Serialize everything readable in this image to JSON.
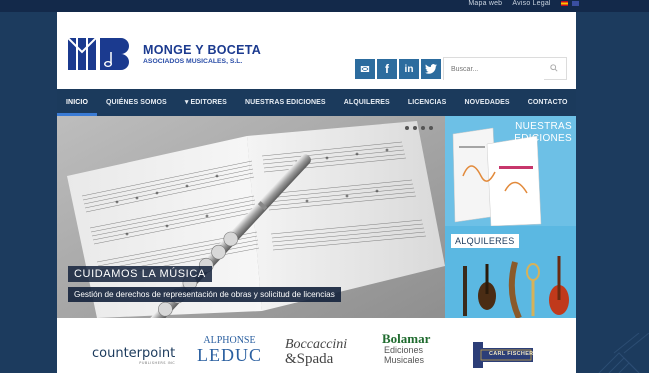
{
  "top_links": [
    "Mapa web",
    "Aviso Legal"
  ],
  "colors": {
    "page_bg": "#1c3b5e",
    "nav_bg": "#1b3a5c",
    "brand_blue": "#1b3a8f",
    "social_bg": "#2c6c9e",
    "side_panel": "#6dc0e6"
  },
  "brand": {
    "name": "MONGE Y BOCETA",
    "sub": "ASOCIADOS MUSICALES, S.L."
  },
  "social": [
    {
      "icon": "mail-icon",
      "glyph": "✉"
    },
    {
      "icon": "facebook-icon",
      "glyph": "f"
    },
    {
      "icon": "linkedin-icon",
      "glyph": "in"
    },
    {
      "icon": "twitter-icon",
      "glyph": "🐦"
    }
  ],
  "search": {
    "placeholder": "Buscar..."
  },
  "nav": [
    "INICIO",
    "QUIÉNES SOMOS",
    "▾ EDITORES",
    "NUESTRAS EDICIONES",
    "ALQUILERES",
    "LICENCIAS",
    "NOVEDADES",
    "CONTACTO"
  ],
  "slider": {
    "caption_title": "CUIDAMOS LA MÚSICA",
    "caption_text": "Gestión de derechos de representación de obras y solicitud de licencias"
  },
  "side_panels": {
    "ediciones_line1": "NUESTRAS",
    "ediciones_line2": "EDICIONES",
    "alquileres": "ALQUILERES"
  },
  "partner_logos": {
    "counterpoint": "counterpoint",
    "counterpoint_sub": "PUBLISHERS INC",
    "alphonse": "ALPHONSE",
    "leduc": "LEDUC",
    "boccaccini": "Boccaccini",
    "spada": "&Spada",
    "bolamar": "Bolamar",
    "bolamar_sub": "Ediciones",
    "bolamar_sub2": "Musicales",
    "carl_fischer": "CARL FISCHER"
  }
}
